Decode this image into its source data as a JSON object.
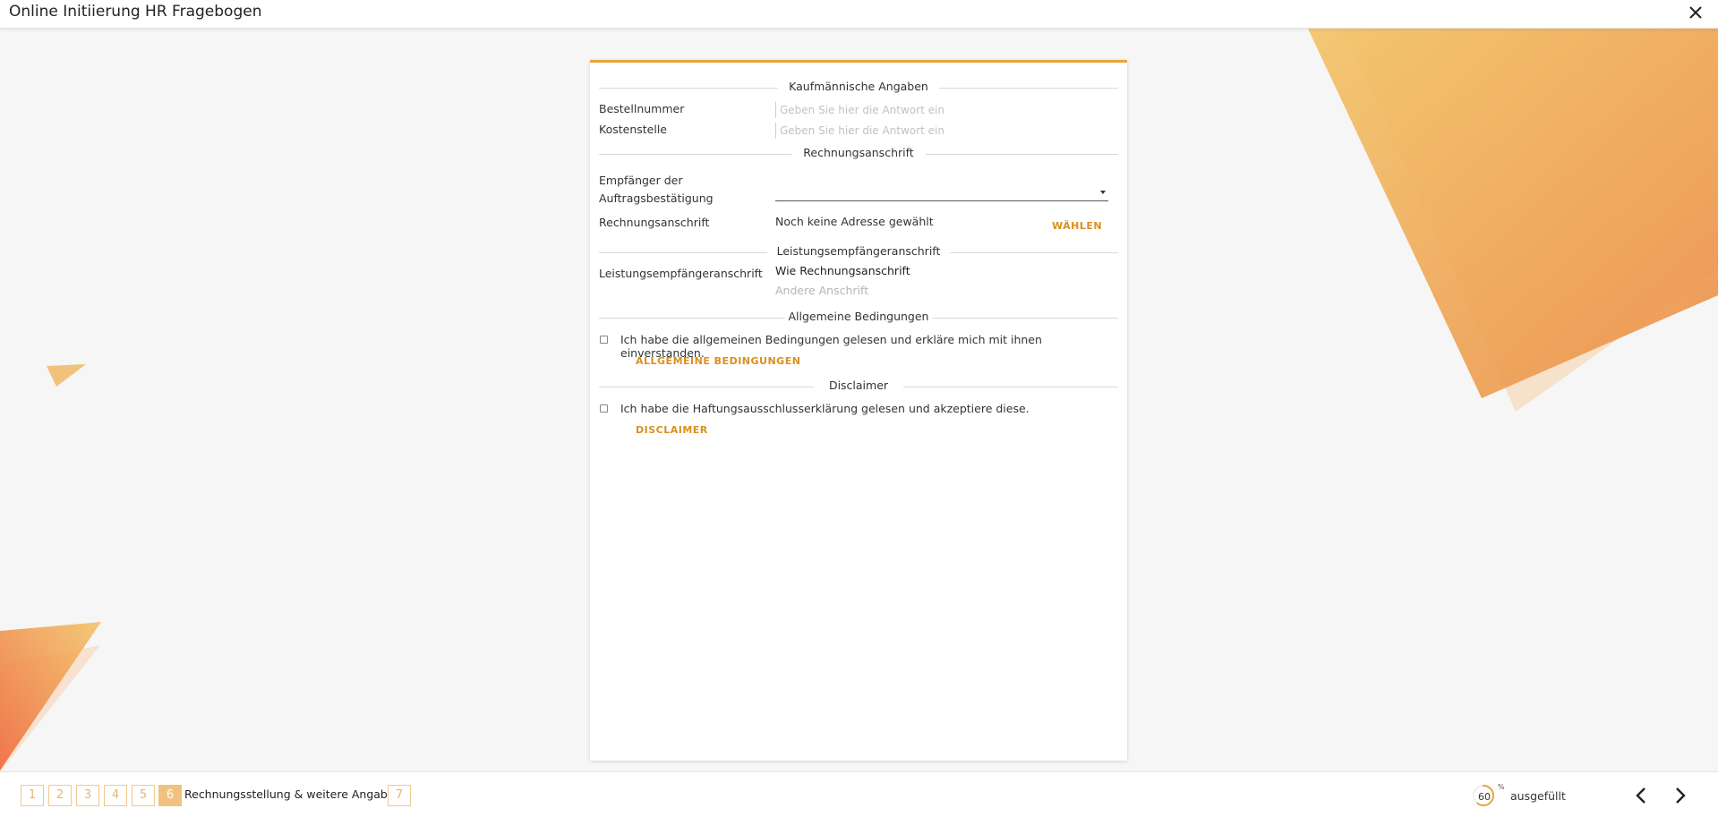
{
  "header": {
    "title": "Online Initiierung HR Fragebogen"
  },
  "form": {
    "sections": {
      "kaufmaennisch": "Kaufmännische Angaben",
      "rechnungsanschrift": "Rechnungsanschrift",
      "leistungsempfaenger": "Leistungsempfängeranschrift",
      "bedingungen": "Allgemeine Bedingungen",
      "disclaimer": "Disclaimer"
    },
    "bestellnummer": {
      "label": "Bestellnummer",
      "placeholder": "Geben Sie hier die Antwort ein",
      "value": ""
    },
    "kostenstelle": {
      "label": "Kostenstelle",
      "placeholder": "Geben Sie hier die Antwort ein",
      "value": ""
    },
    "empfaenger": {
      "label_line1": "Empfänger der",
      "label_line2": "Auftragsbestätigung",
      "value": ""
    },
    "rechnung": {
      "label": "Rechnungsanschrift",
      "value": "Noch keine Adresse gewählt",
      "action": "WÄHLEN"
    },
    "leistung": {
      "label": "Leistungsempfängeranschrift",
      "options": [
        "Wie Rechnungsanschrift",
        "Andere Anschrift"
      ],
      "selected": "Wie Rechnungsanschrift"
    },
    "agb": {
      "text": "Ich habe die allgemeinen Bedingungen gelesen und erkläre mich mit ihnen einverstanden.",
      "link": "ALLGEMEINE BEDINGUNGEN",
      "checked": false
    },
    "haftung": {
      "text": "Ich habe die Haftungsausschlusserklärung gelesen und akzeptiere diese.",
      "link": "DISCLAIMER",
      "checked": false
    }
  },
  "footer": {
    "steps": [
      "1",
      "2",
      "3",
      "4",
      "5",
      "6",
      "7"
    ],
    "active_step": "6",
    "active_step_title": "Rechnungsstellung & weitere Angaben",
    "progress": {
      "value": "60",
      "unit": "%",
      "label": "ausgefüllt",
      "fraction": 0.6
    }
  },
  "colors": {
    "accent": "#e8a33c",
    "link": "#d9901e",
    "step_active": "#f1c27f"
  },
  "icons": {
    "close": "close-icon",
    "prev": "chevron-left-icon",
    "next": "chevron-right-icon",
    "dropdown": "caret-down-icon"
  }
}
